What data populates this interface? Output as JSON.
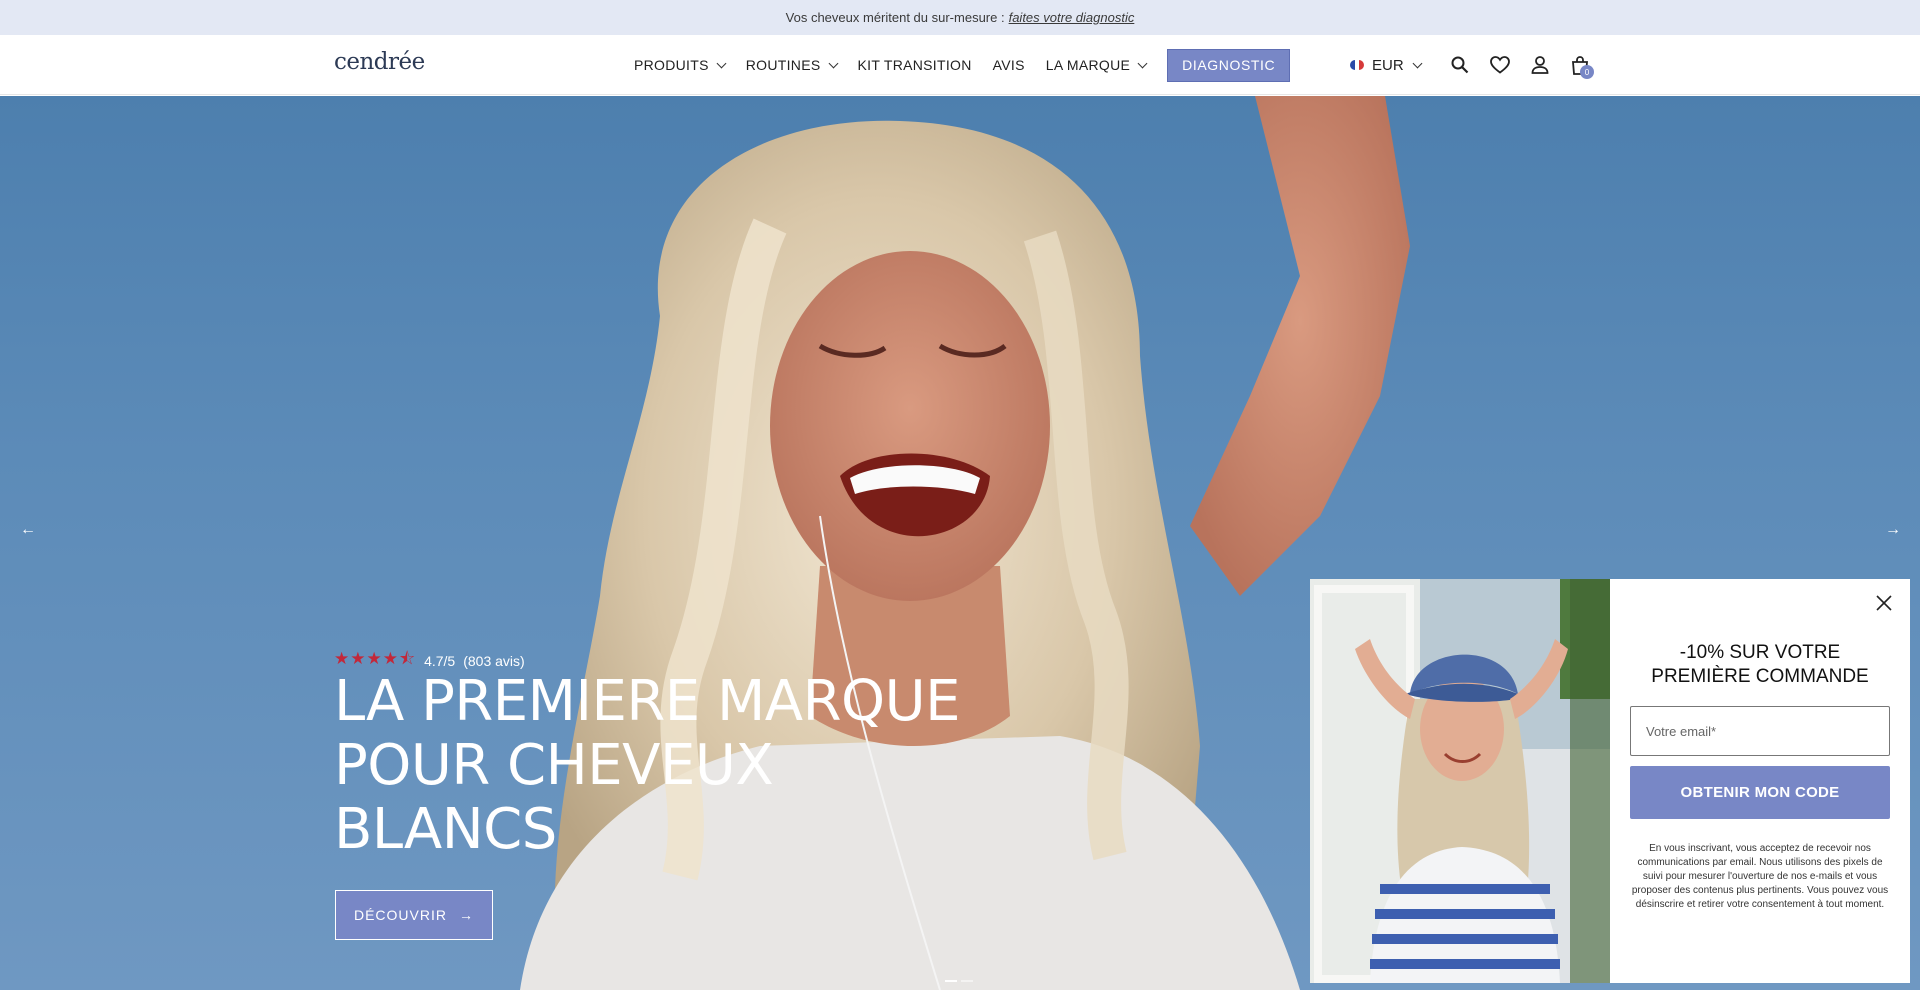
{
  "announcement": {
    "text": "Vos cheveux méritent du sur-mesure :",
    "link": "faites votre diagnostic"
  },
  "header": {
    "logo": "cendrée",
    "nav": [
      {
        "label": "PRODUITS",
        "has_dropdown": true
      },
      {
        "label": "ROUTINES",
        "has_dropdown": true
      },
      {
        "label": "KIT TRANSITION",
        "has_dropdown": false
      },
      {
        "label": "AVIS",
        "has_dropdown": false
      },
      {
        "label": "LA MARQUE",
        "has_dropdown": true
      }
    ],
    "cta": "DIAGNOSTIC",
    "currency": "EUR",
    "cart_count": "0",
    "icons": [
      "search-icon",
      "heart-icon",
      "account-icon",
      "cart-icon"
    ]
  },
  "hero": {
    "rating": "4.7/5",
    "reviews": "(803 avis)",
    "title_lines": [
      "LA PREMIERE MARQUE",
      "POUR CHEVEUX",
      "BLANCS"
    ],
    "cta": "DÉCOUVRIR",
    "cta_arrow": "→",
    "prev_arrow": "←",
    "next_arrow": "→"
  },
  "popup": {
    "title_lines": [
      "-10% SUR VOTRE",
      "PREMIÈRE COMMANDE"
    ],
    "email_placeholder": "Votre email*",
    "button": "OBTENIR MON CODE",
    "legal": "En vous inscrivant, vous acceptez de recevoir nos communications par email. Nous utilisons des pixels de suivi pour mesurer l'ouverture de nos e-mails et vous proposer des contenus plus pertinents. Vous pouvez vous désinscrire et retirer votre consentement à tout moment."
  },
  "colors": {
    "accent": "#7887c6",
    "announcement_bg": "#e3e8f4",
    "star": "#c2283a",
    "sky": "#5c8bb8"
  }
}
